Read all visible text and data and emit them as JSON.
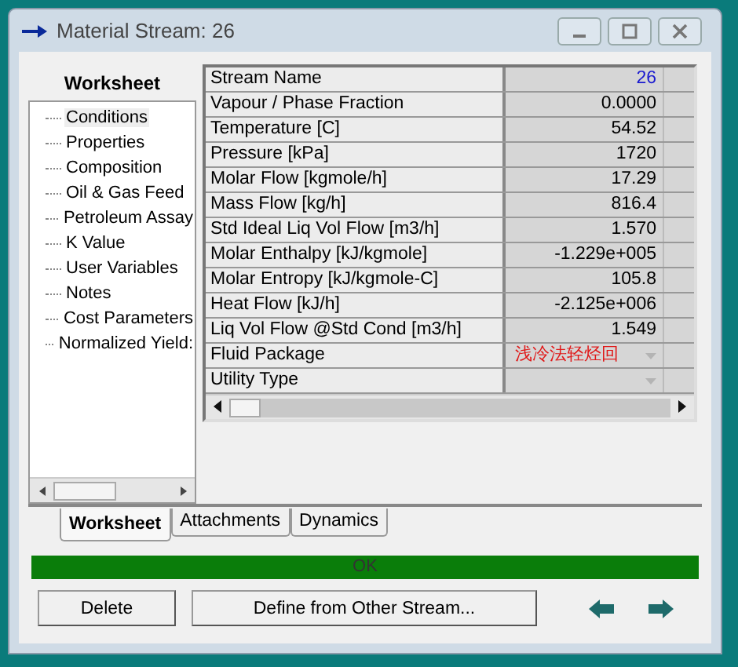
{
  "window": {
    "title": "Material Stream: 26"
  },
  "sidebar": {
    "title": "Worksheet",
    "items": [
      {
        "label": "Conditions",
        "selected": true
      },
      {
        "label": "Properties",
        "selected": false
      },
      {
        "label": "Composition",
        "selected": false
      },
      {
        "label": "Oil & Gas Feed",
        "selected": false
      },
      {
        "label": "Petroleum Assay",
        "selected": false
      },
      {
        "label": "K Value",
        "selected": false
      },
      {
        "label": "User Variables",
        "selected": false
      },
      {
        "label": "Notes",
        "selected": false
      },
      {
        "label": "Cost Parameters",
        "selected": false
      },
      {
        "label": "Normalized Yield:",
        "selected": false
      }
    ]
  },
  "table": {
    "rows": [
      {
        "label": "Stream Name",
        "value": "26",
        "kind": "input"
      },
      {
        "label": "Vapour / Phase Fraction",
        "value": "0.0000",
        "kind": "number"
      },
      {
        "label": "Temperature [C]",
        "value": "54.52",
        "kind": "number"
      },
      {
        "label": "Pressure [kPa]",
        "value": "1720",
        "kind": "number"
      },
      {
        "label": "Molar Flow [kgmole/h]",
        "value": "17.29",
        "kind": "number"
      },
      {
        "label": "Mass Flow [kg/h]",
        "value": "816.4",
        "kind": "number"
      },
      {
        "label": "Std Ideal Liq Vol Flow [m3/h]",
        "value": "1.570",
        "kind": "number"
      },
      {
        "label": "Molar Enthalpy [kJ/kgmole]",
        "value": "-1.229e+005",
        "kind": "number"
      },
      {
        "label": "Molar Entropy [kJ/kgmole-C]",
        "value": "105.8",
        "kind": "number"
      },
      {
        "label": "Heat Flow [kJ/h]",
        "value": "-2.125e+006",
        "kind": "number"
      },
      {
        "label": "Liq Vol Flow @Std Cond [m3/h]",
        "value": "1.549",
        "kind": "number"
      },
      {
        "label": "Fluid Package",
        "value": "浅冷法轻烃回",
        "kind": "dropdown"
      },
      {
        "label": "Utility Type",
        "kind": "dropdown"
      }
    ]
  },
  "tabs": [
    {
      "label": "Worksheet",
      "selected": true
    },
    {
      "label": "Attachments",
      "selected": false
    },
    {
      "label": "Dynamics",
      "selected": false
    }
  ],
  "status_bar": {
    "text": "OK"
  },
  "buttons": [
    "Delete",
    "Define from Other Stream..."
  ]
}
